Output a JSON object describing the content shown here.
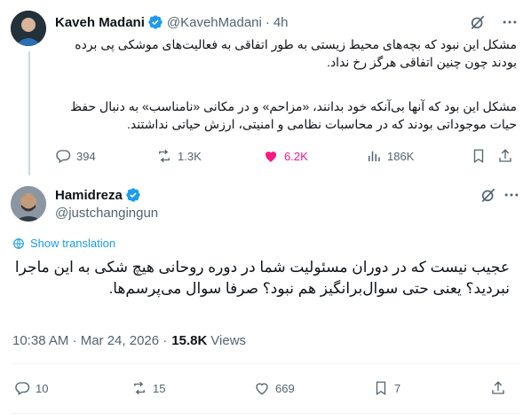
{
  "parent": {
    "name": "Kaveh Madani",
    "handle": "@KavehMadani",
    "separator": "·",
    "time": "4h",
    "paragraph1": "مشکل این نبود که بچه‌های محیط زیستی به طور اتفاقی به فعالیت‌های موشکی پی برده بودند چون چنین اتفاقی هرگز رخ نداد.",
    "paragraph2": "مشکل این بود که آنها بی‌آنکه خود بدانند، «مزاحم» و در مکانی «نامناسب» به دنبال حفظ حیات موجوداتی بودند که در محاسبات نظامی و امنیتی، ارزش حیاتی نداشتند.",
    "actions": {
      "replies": "394",
      "reposts": "1.3K",
      "likes": "6.2K",
      "views": "186K"
    }
  },
  "reply": {
    "name": "Hamidreza",
    "handle": "@justchangingun",
    "show_translation": "Show translation",
    "text": "عجیب نیست که در دوران مسئولیت شما در دوره روحانی هیچ شکی به این ماجرا نبردید؟ یعنی حتی سوال‌برانگیز هم نبود؟ صرفا سوال می‌پرسم‌ها.",
    "timestamp": "10:38 AM · Mar 24, 2026 ·",
    "views_count": "15.8K",
    "views_label": "Views",
    "actions": {
      "replies": "10",
      "reposts": "15",
      "likes": "669",
      "bookmarks": "7"
    }
  },
  "colors": {
    "accent": "#1d9bf0",
    "like": "#f91880",
    "muted": "#536471",
    "text": "#0f1419",
    "border": "#cfd9de"
  },
  "icons": [
    "verified-badge-icon",
    "grok-icon",
    "more-icon",
    "reply-icon",
    "repost-icon",
    "like-icon",
    "views-icon",
    "bookmark-icon",
    "share-icon",
    "translate-icon"
  ]
}
